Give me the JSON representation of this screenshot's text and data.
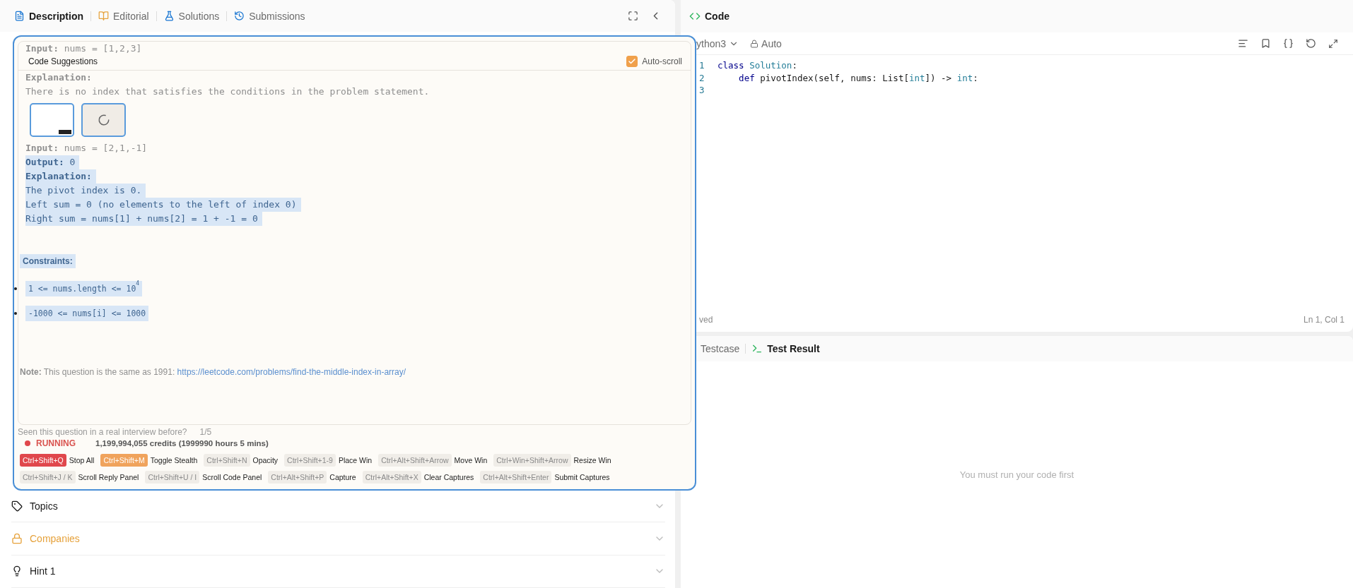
{
  "left_tabs": [
    {
      "label": "Description",
      "kind": "description",
      "selected": true
    },
    {
      "label": "Editorial",
      "kind": "editorial",
      "selected": false
    },
    {
      "label": "Solutions",
      "kind": "solutions",
      "selected": false
    },
    {
      "label": "Submissions",
      "kind": "submissions",
      "selected": false
    }
  ],
  "overlay": {
    "top_line": {
      "text": "**Input:** nums = [1,2,3]",
      "highlighted": false
    },
    "title": "Code Suggestions",
    "auto_scroll": {
      "label": "Auto-scroll",
      "checked": true
    },
    "content_before": [
      {
        "text": "**Explanation:**",
        "highlighted": false
      },
      {
        "text": "There is no index that satisfies the conditions in the problem statement.",
        "highlighted": false
      }
    ],
    "thumbnails": [
      {
        "kind": "screenshot"
      },
      {
        "kind": "loading"
      }
    ],
    "content": [
      {
        "text": "**Input:** nums = [2,1,-1]",
        "kind": "mono",
        "highlighted": false
      },
      {
        "text": "**Output:** 0",
        "kind": "mono",
        "highlighted": true
      },
      {
        "text": "**Explanation:**",
        "kind": "mono",
        "highlighted": true
      },
      {
        "text": "The pivot index is 0.",
        "kind": "mono",
        "highlighted": true
      },
      {
        "text": "Left sum = 0 (no elements to the left of index 0)",
        "kind": "mono",
        "highlighted": true
      },
      {
        "text": "Right sum = nums[1] + nums[2] = 1 + -1 = 0",
        "kind": "mono",
        "highlighted": true
      },
      {
        "text": "Constraints:",
        "kind": "heading",
        "highlighted": true
      },
      {
        "text": "1 <= nums.length <= 10$^{4}$",
        "kind": "bullet",
        "highlighted": true
      },
      {
        "text": "-1000 <= nums[i] <= 1000",
        "kind": "bullet",
        "highlighted": true
      }
    ],
    "note": {
      "text": "**Note:** This question is the same as 1991:",
      "link": "https://leetcode.com/problems/find-the-middle-index-in-array/"
    },
    "question_prompt": "Seen this question in a real interview before?",
    "question_count": "1/5",
    "status": {
      "kind": "running",
      "label": "RUNNING",
      "credits": "1,199,994,055 credits (1999990 hours 5 mins)"
    },
    "shortcut_rows": [
      [
        {
          "keys": "Ctrl+Shift+Q",
          "action": "Stop All",
          "kind": "danger"
        },
        {
          "keys": "Ctrl+Shift+M",
          "action": "Toggle Stealth",
          "kind": "warning"
        },
        {
          "keys": "Ctrl+Shift+N",
          "action": "Opacity",
          "kind": "plain"
        },
        {
          "keys": "Ctrl+Shift+1-9",
          "action": "Place Win",
          "kind": "plain"
        },
        {
          "keys": "Ctrl+Alt+Shift+Arrow",
          "action": "Move Win",
          "kind": "plain"
        },
        {
          "keys": "Ctrl+Win+Shift+Arrow",
          "action": "Resize Win",
          "kind": "plain"
        }
      ],
      [
        {
          "keys": "Ctrl+Shift+J / K",
          "action": "Scroll Reply Panel",
          "kind": "plain"
        },
        {
          "keys": "Ctrl+Shift+U / I",
          "action": "Scroll Code Panel",
          "kind": "plain"
        },
        {
          "keys": "Ctrl+Alt+Shift+P",
          "action": "Capture",
          "kind": "plain"
        },
        {
          "keys": "Ctrl+Alt+Shift+X",
          "action": "Clear Captures",
          "kind": "plain"
        },
        {
          "keys": "Ctrl+Alt+Shift+Enter",
          "action": "Submit Captures",
          "kind": "plain"
        }
      ]
    ]
  },
  "sections": [
    {
      "label": "Topics",
      "kind": "topics"
    },
    {
      "label": "Companies",
      "kind": "locked"
    },
    {
      "label": "Hint 1",
      "kind": "hint"
    }
  ],
  "editor": {
    "title": "Code",
    "language": "ython3",
    "mode": "Auto",
    "lines": [
      {
        "number": "1",
        "tokens": [
          {
            "text": "class",
            "kind": "keyword"
          },
          {
            "text": " Solution",
            "kind": "type"
          },
          {
            "text": ":",
            "kind": "plain"
          }
        ]
      },
      {
        "number": "2",
        "tokens": [
          {
            "text": "    def",
            "kind": "keyword"
          },
          {
            "text": " pivotIndex(self, nums: List[",
            "kind": "plain"
          },
          {
            "text": "int",
            "kind": "type"
          },
          {
            "text": "]) -> ",
            "kind": "plain"
          },
          {
            "text": "int",
            "kind": "type"
          },
          {
            "text": ":",
            "kind": "plain"
          }
        ]
      },
      {
        "number": "3"
      }
    ],
    "status_left": "ved",
    "cursor": "Ln 1, Col 1"
  },
  "result_panel": {
    "tabs": [
      {
        "label": "Testcase",
        "kind": "testcase",
        "selected": false
      },
      {
        "label": "Test Result",
        "kind": "result",
        "selected": true
      }
    ],
    "message": "You must run your code first"
  }
}
